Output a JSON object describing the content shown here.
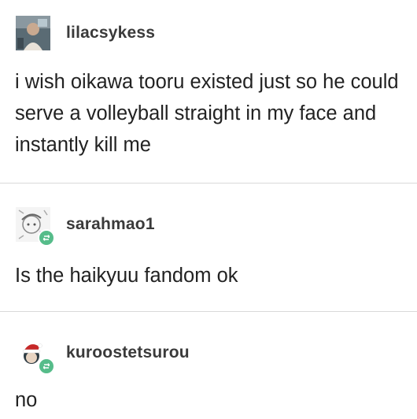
{
  "posts": [
    {
      "username": "lilacsykess",
      "text": "i wish oikawa tooru existed just so he could serve a volleyball straight in my face and instantly kill me",
      "avatar_icon": "user-photo-avatar",
      "reblog": false
    },
    {
      "username": "sarahmao1",
      "text": "Is the haikyuu fandom ok",
      "avatar_icon": "drawn-character-avatar",
      "reblog": true
    },
    {
      "username": "kuroostetsurou",
      "text": "no",
      "avatar_icon": "santa-hat-character-avatar",
      "reblog": true
    }
  ],
  "colors": {
    "reblog_badge": "#56bc8a",
    "divider": "#d9d9d9",
    "text": "#222222"
  }
}
